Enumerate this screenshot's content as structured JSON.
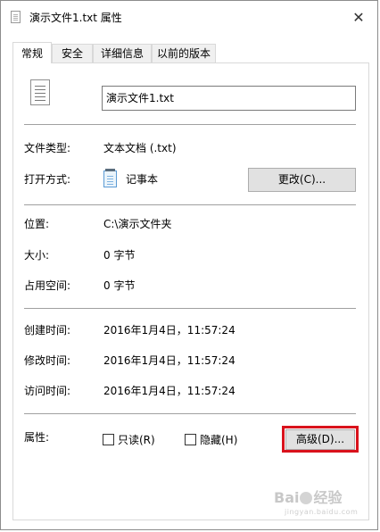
{
  "window": {
    "title": "演示文件1.txt 属性",
    "close_glyph": "✕"
  },
  "tabs": [
    {
      "label": "常规",
      "active": true
    },
    {
      "label": "安全",
      "active": false
    },
    {
      "label": "详细信息",
      "active": false
    },
    {
      "label": "以前的版本",
      "active": false
    }
  ],
  "general": {
    "file_name": "演示文件1.txt",
    "file_type_label": "文件类型:",
    "file_type_value": "文本文档 (.txt)",
    "opens_with_label": "打开方式:",
    "opens_with_value": "记事本",
    "change_button": "更改(C)...",
    "location_label": "位置:",
    "location_value": "C:\\演示文件夹",
    "size_label": "大小:",
    "size_value": "0 字节",
    "size_on_disk_label": "占用空间:",
    "size_on_disk_value": "0 字节",
    "created_label": "创建时间:",
    "created_value": "2016年1月4日，11:57:24",
    "modified_label": "修改时间:",
    "modified_value": "2016年1月4日，11:57:24",
    "accessed_label": "访问时间:",
    "accessed_value": "2016年1月4日，11:57:24",
    "attributes_label": "属性:",
    "readonly_label": "只读(R)",
    "readonly_checked": false,
    "hidden_label": "隐藏(H)",
    "hidden_checked": false,
    "advanced_button": "高级(D)..."
  },
  "watermark": {
    "brand": "Bai",
    "brand_end": "经验",
    "sub": "jingyan.baidu.com"
  },
  "colors": {
    "highlight": "#d9121c",
    "button_bg": "#e1e1e1",
    "separator": "#a0a0a0"
  }
}
